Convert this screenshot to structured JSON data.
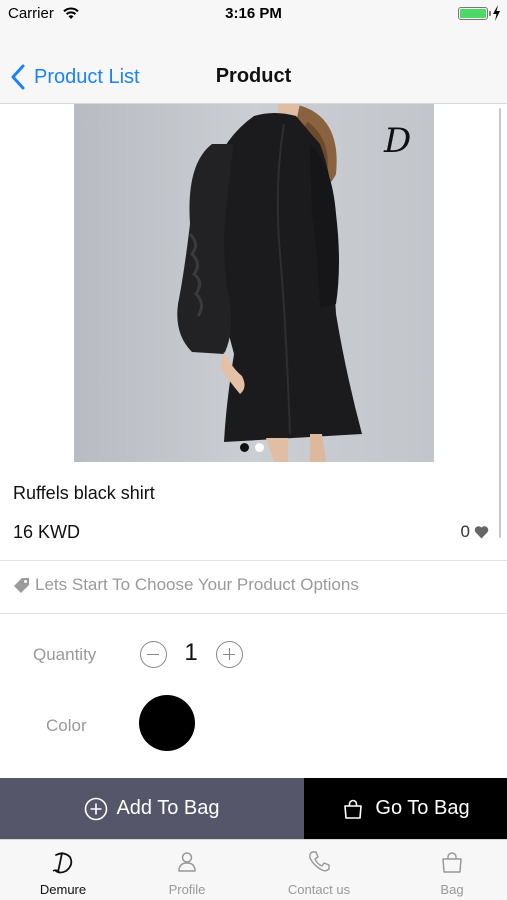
{
  "status_bar": {
    "carrier": "Carrier",
    "time": "3:16 PM"
  },
  "nav": {
    "back_label": "Product List",
    "title": "Product"
  },
  "product": {
    "name": "Ruffels black shirt",
    "price": "16 KWD",
    "likes": "0",
    "brand_mark": "D",
    "image_pages": 2,
    "current_image_page": 1
  },
  "options": {
    "hint": "Lets Start To Choose Your Product Options",
    "quantity_label": "Quantity",
    "quantity_value": "1",
    "color_label": "Color",
    "selected_color": "#000000"
  },
  "actions": {
    "add_to_bag": "Add To Bag",
    "go_to_bag": "Go To Bag"
  },
  "tabs": [
    {
      "label": "Demure",
      "icon": "brand-logo-icon",
      "active": true
    },
    {
      "label": "Profile",
      "icon": "person-icon",
      "active": false
    },
    {
      "label": "Contact us",
      "icon": "phone-icon",
      "active": false
    },
    {
      "label": "Bag",
      "icon": "shopping-bag-icon",
      "active": false
    }
  ],
  "colors": {
    "accent": "#1a82fb",
    "add_button_bg": "#55566a",
    "go_button_bg": "#000000"
  }
}
